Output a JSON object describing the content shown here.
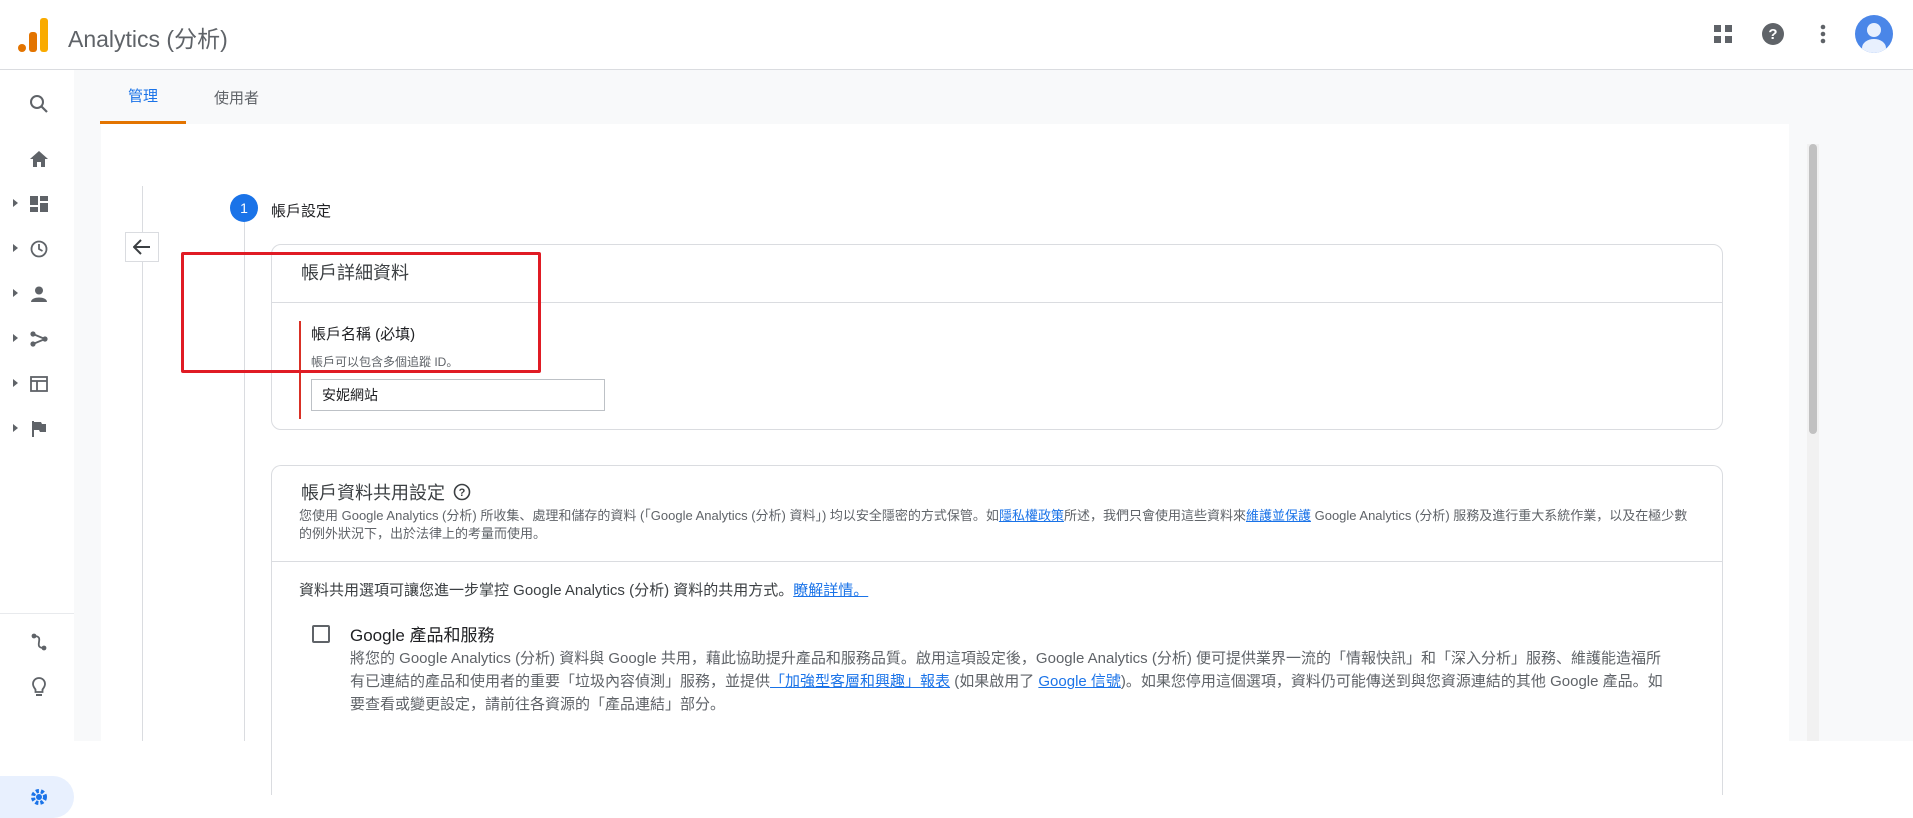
{
  "app": {
    "title": "Analytics (分析)"
  },
  "tabs": [
    {
      "label": "管理"
    },
    {
      "label": "使用者"
    }
  ],
  "step": {
    "number": "1",
    "title": "帳戶設定"
  },
  "account_details": {
    "title": "帳戶詳細資料",
    "field_label": "帳戶名稱 (必填)",
    "field_help": "帳戶可以包含多個追蹤 ID。",
    "field_value": "安妮網站"
  },
  "data_sharing": {
    "title": "帳戶資料共用設定",
    "desc_part1": "您使用 Google Analytics (分析) 所收集、處理和儲存的資料 (「Google Analytics (分析) 資料」) 均以安全隱密的方式保管。如",
    "privacy_link": "隱私權政策",
    "desc_part2": "所述，我們只會使用這些資料來",
    "maintain_link": "維護並保護",
    "desc_part3": " Google Analytics (分析) 服務及進行重大系統作業，以及在極少數的例外狀況下，出於法律上的考量而使用。",
    "intro_text": "資料共用選項可讓您進一步掌控 Google Analytics (分析) 資料的共用方式。",
    "learn_more": "瞭解詳情。",
    "option": {
      "title": "Google 產品和服務",
      "desc_part1": "將您的 Google Analytics (分析) 資料與 Google 共用，藉此協助提升產品和服務品質。啟用這項設定後，Google Analytics (分析) 便可提供業界一流的「情報快訊」和「深入分析」服務、維護能造福所有已連結的產品和使用者的重要「垃圾內容偵測」服務，並提供",
      "link1": "「加強型客層和興趣」報表",
      "desc_part2": " (如果啟用了 ",
      "link2": "Google 信號",
      "desc_part3": ")。如果您停用這個選項，資料仍可能傳送到與您資源連結的其他 Google 產品。如要查看或變更設定，請前往各資源的「產品連結」部分。"
    }
  },
  "icons": {
    "search": "search-icon",
    "home": "home-icon",
    "dashboard": "dashboard-icon",
    "realtime": "clock-icon",
    "audience": "person-icon",
    "acquisition": "acquisition-icon",
    "behavior": "behavior-icon",
    "conversions": "flag-icon",
    "attribution": "attribution-icon",
    "discover": "lightbulb-icon",
    "admin": "gear-icon",
    "apps": "apps-grid-icon",
    "help": "help-icon",
    "more": "more-vert-icon",
    "account": "account-avatar-icon",
    "back": "arrow-back-icon"
  },
  "colors": {
    "accent": "#1a73e8",
    "tab_indicator": "#e37400",
    "error": "#d93025"
  }
}
